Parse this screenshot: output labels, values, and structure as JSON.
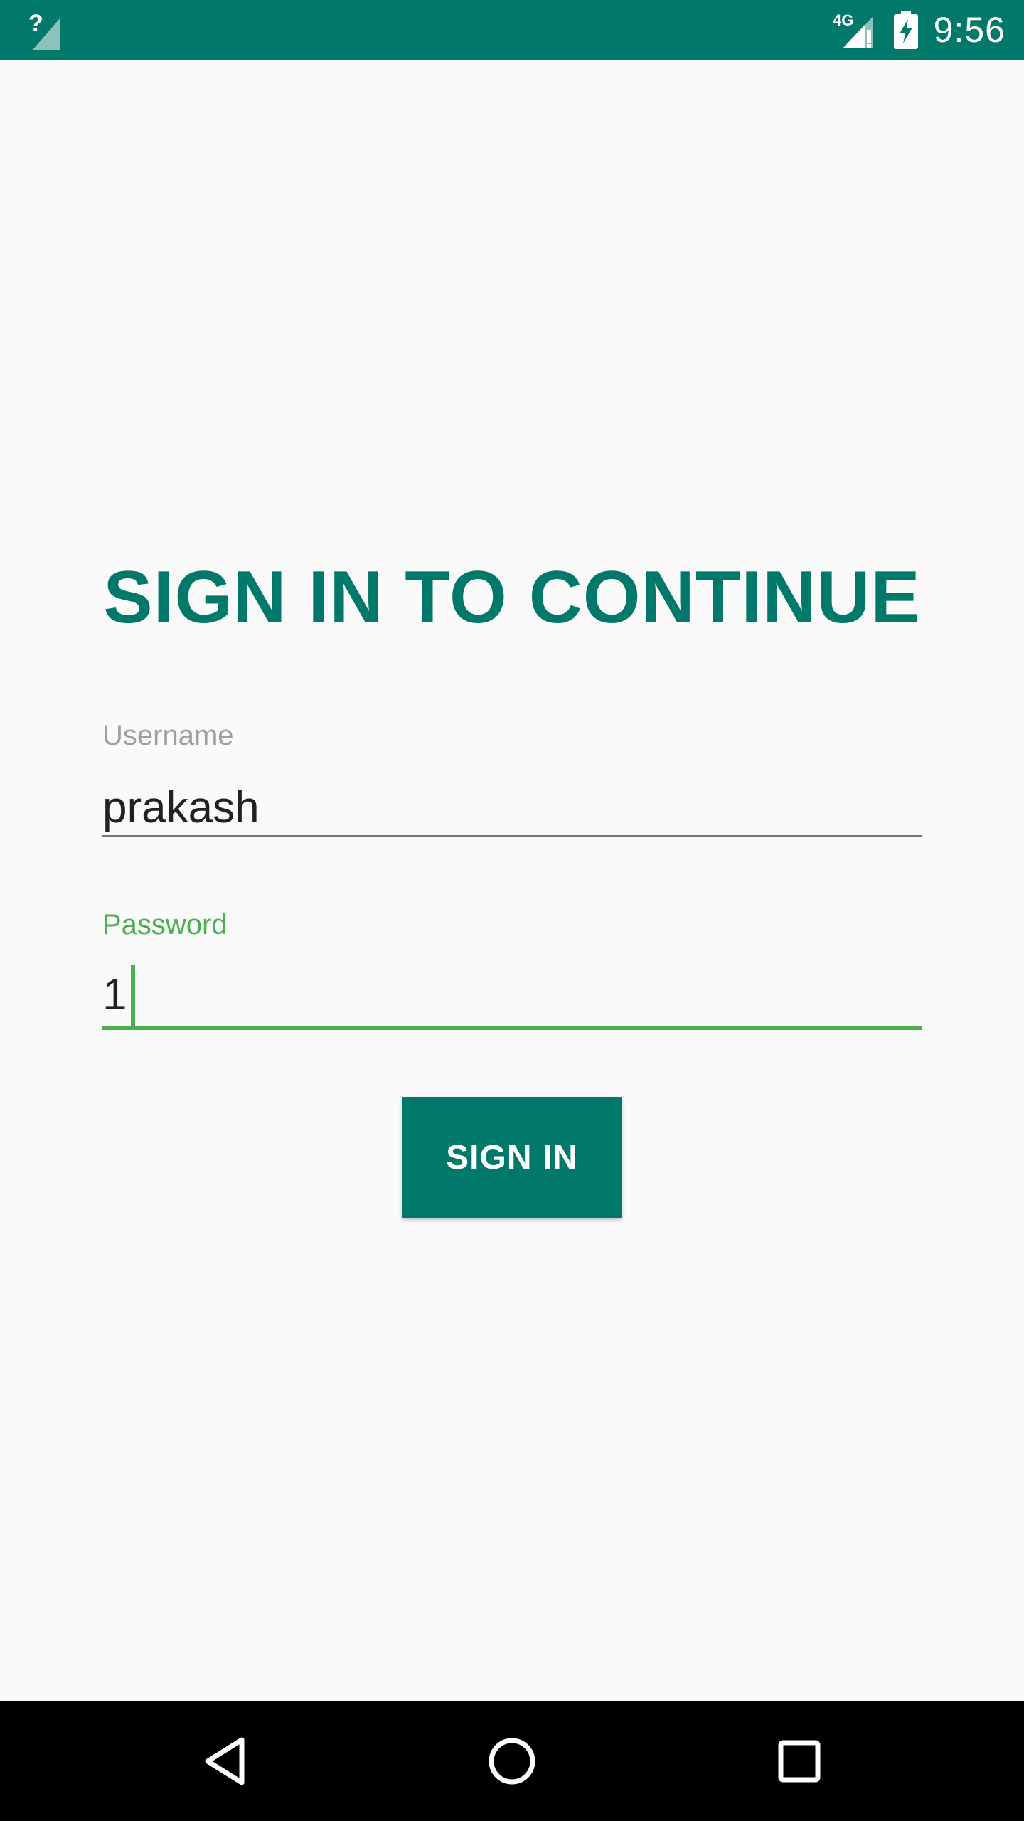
{
  "status_bar": {
    "time": "9:56",
    "network_label": "4G",
    "unknown_signal_label": "?",
    "icons": [
      "signal-unknown-icon",
      "signal-4g-icon",
      "battery-charging-icon"
    ],
    "background_color": "#00796b"
  },
  "login": {
    "title": "SIGN IN TO CONTINUE",
    "username": {
      "label": "Username",
      "value": "prakash"
    },
    "password": {
      "label": "Password",
      "value": "1",
      "focused": true
    },
    "sign_in_label": "SIGN IN"
  },
  "navigation_bar": {
    "icons": [
      "back-icon",
      "home-icon",
      "recents-icon"
    ]
  },
  "colors": {
    "primary": "#00796b",
    "accent": "#4caf50",
    "background": "#fafafa"
  }
}
